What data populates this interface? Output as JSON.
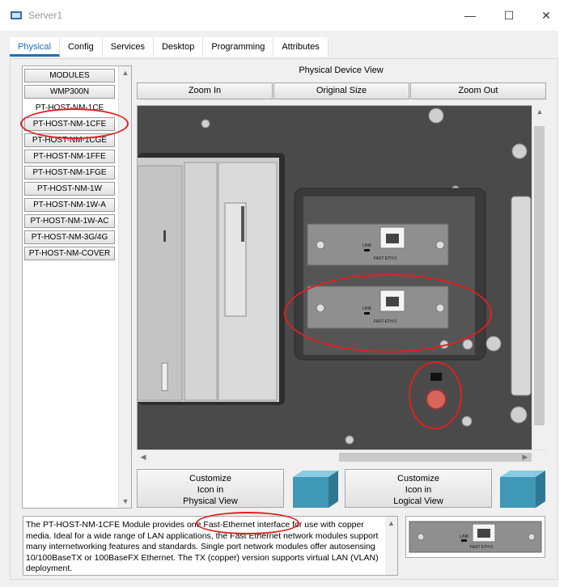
{
  "window": {
    "title": "Server1",
    "minimize_glyph": "—",
    "maximize_glyph": "☐",
    "close_glyph": "✕"
  },
  "tabs": [
    {
      "label": "Physical",
      "active": true
    },
    {
      "label": "Config"
    },
    {
      "label": "Services"
    },
    {
      "label": "Desktop"
    },
    {
      "label": "Programming"
    },
    {
      "label": "Attributes"
    }
  ],
  "modules": {
    "header": "MODULES",
    "items": [
      "WMP300N",
      "PT-HOST-NM-1CE",
      "PT-HOST-NM-1CFE",
      "PT-HOST-NM-1CGE",
      "PT-HOST-NM-1FFE",
      "PT-HOST-NM-1FGE",
      "PT-HOST-NM-1W",
      "PT-HOST-NM-1W-A",
      "PT-HOST-NM-1W-AC",
      "PT-HOST-NM-3G/4G",
      "PT-HOST-NM-COVER"
    ]
  },
  "device_view": {
    "title": "Physical Device View",
    "zoom_in": "Zoom In",
    "original_size": "Original Size",
    "zoom_out": "Zoom Out",
    "port_link_label": "LINK",
    "port_label": "FAST ETH 0"
  },
  "customize": {
    "physical": [
      "Customize",
      "Icon in",
      "Physical View"
    ],
    "logical": [
      "Customize",
      "Icon in",
      "Logical View"
    ]
  },
  "description": "The PT-HOST-NM-1CFE Module provides one Fast-Ethernet interface for use with copper media. Ideal for a wide range of LAN applications, the Fast Ethernet network modules support many internetworking features and standards. Single port network modules offer autosensing 10/100BaseTX or 100BaseFX Ethernet. The TX (copper) version supports virtual LAN (VLAN) deployment.",
  "colors": {
    "accent": "#1e6fb8",
    "annotation": "#e02020",
    "chassis": "#4a4a4a"
  }
}
